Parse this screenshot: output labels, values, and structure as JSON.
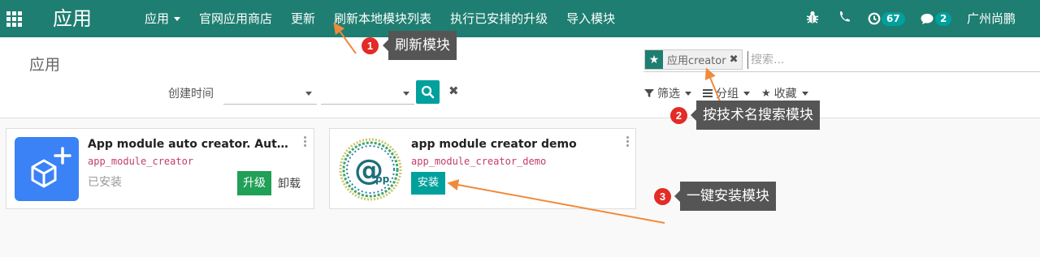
{
  "navbar": {
    "brand": "应用",
    "menu": [
      {
        "label": "应用",
        "dropdown": true
      },
      {
        "label": "官网应用商店",
        "dropdown": false
      },
      {
        "label": "更新",
        "dropdown": false
      },
      {
        "label": "刷新本地模块列表",
        "dropdown": false
      },
      {
        "label": "执行已安排的升级",
        "dropdown": false
      },
      {
        "label": "导入模块",
        "dropdown": false
      }
    ],
    "activities_count": "67",
    "messages_count": "2",
    "user": "广州尚鹏",
    "bg_color": "#1e7e71"
  },
  "control_panel": {
    "breadcrumb": "应用",
    "facet_value": "应用creator",
    "search_placeholder": "搜索...",
    "groupby_label": "创建时间",
    "filter_label": "筛选",
    "groupby_button": "分组",
    "favorites_label": "收藏"
  },
  "cards": [
    {
      "name": "App module auto creator. Auto develop odoo module",
      "technical_name": "app_module_creator",
      "status": "已安装",
      "upgrade_label": "升级",
      "uninstall_label": "卸载",
      "icon": "cube-plus-icon",
      "icon_color": "#3b82f6"
    },
    {
      "name": "app module creator demo",
      "technical_name": "app_module_creator_demo",
      "install_label": "安装",
      "icon": "at-pp-logo-icon"
    }
  ],
  "annotations": [
    {
      "number": "1",
      "text": "刷新模块"
    },
    {
      "number": "2",
      "text": "按技术名搜索模块"
    },
    {
      "number": "3",
      "text": "一键安装模块"
    }
  ],
  "colors": {
    "accent": "#00a09d",
    "upgrade": "#21a057",
    "tech_name": "#c13c6b",
    "marker": "#e32b27",
    "arrow": "#f08a3c"
  }
}
